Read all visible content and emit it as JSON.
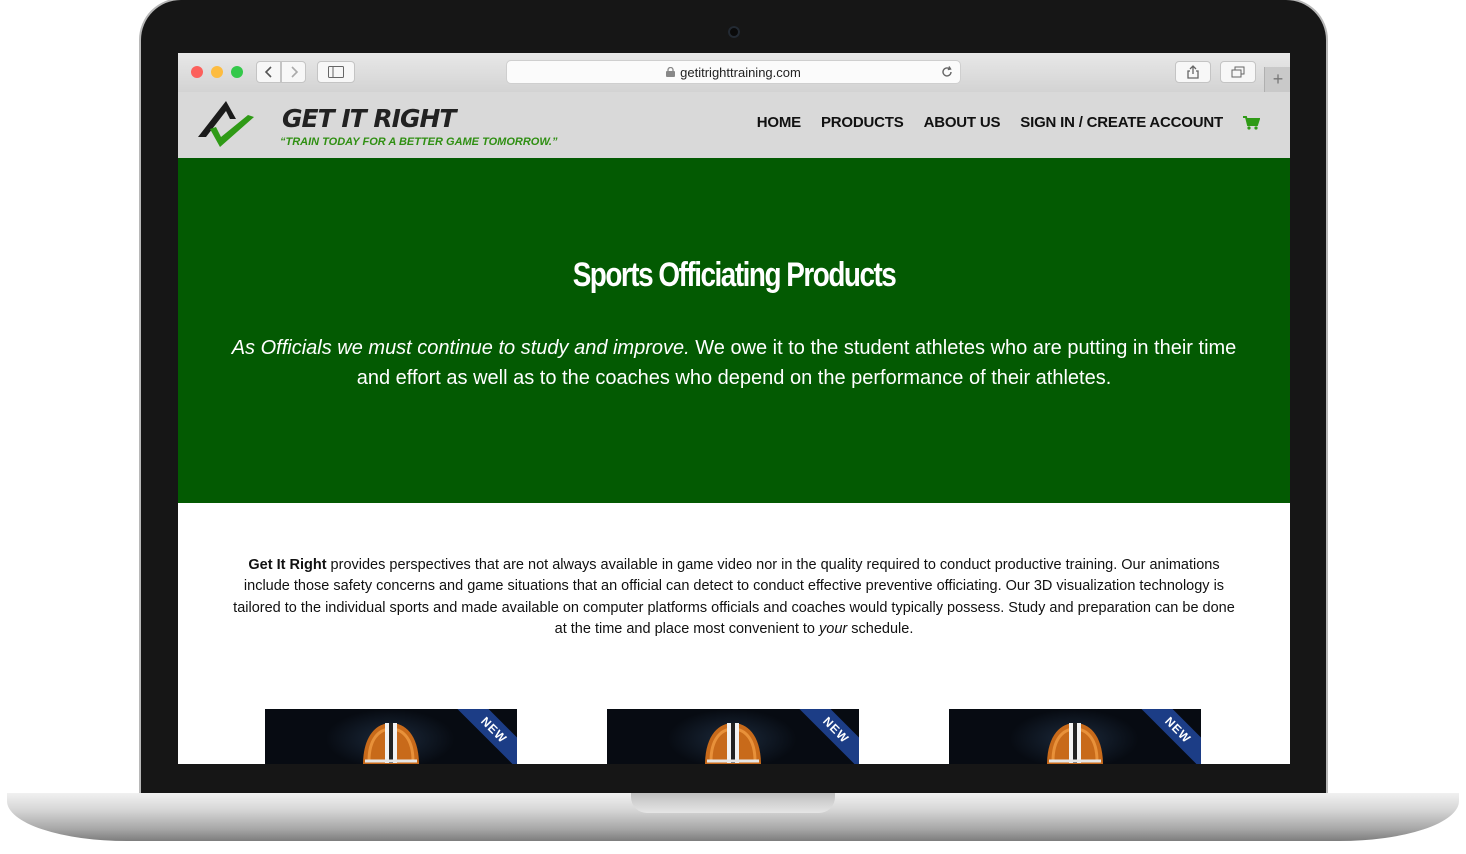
{
  "browser": {
    "url": "getitrighttraining.com"
  },
  "site": {
    "brand": "GET IT RIGHT",
    "tagline": "“TRAIN TODAY FOR A BETTER GAME TOMORROW.”",
    "nav": [
      {
        "label": "HOME"
      },
      {
        "label": "PRODUCTS"
      },
      {
        "label": "ABOUT US"
      },
      {
        "label": "SIGN IN / CREATE ACCOUNT"
      }
    ],
    "colors": {
      "header_bg": "#d9d9d9",
      "hero_bg": "#035a02",
      "accent_green": "#2f8f12",
      "ribbon": "#1c3d86"
    }
  },
  "hero": {
    "title": "Sports Officiating Products",
    "lead_italic": "As Officials we must continue to study and improve.",
    "lead_rest": " We owe it to the student athletes who are putting in their time and effort as well as to the coaches who depend on the performance of their athletes."
  },
  "intro": {
    "bold": "Get It Right",
    "text_1": " provides perspectives that are not always available in game video nor in the quality required to conduct productive training. Our animations include those safety concerns and game situations that an official can detect to conduct effective preventive officiating. Our 3D visualization technology is tailored to the individual sports and made available on computer platforms officials and coaches would typically possess. Study and preparation can be done at the time and place most convenient to ",
    "em": "your",
    "text_2": " schedule."
  },
  "products": [
    {
      "badge": "NEW",
      "image": "football-helmet"
    },
    {
      "badge": "NEW",
      "image": "football-helmet"
    },
    {
      "badge": "NEW",
      "image": "football-helmet"
    }
  ]
}
